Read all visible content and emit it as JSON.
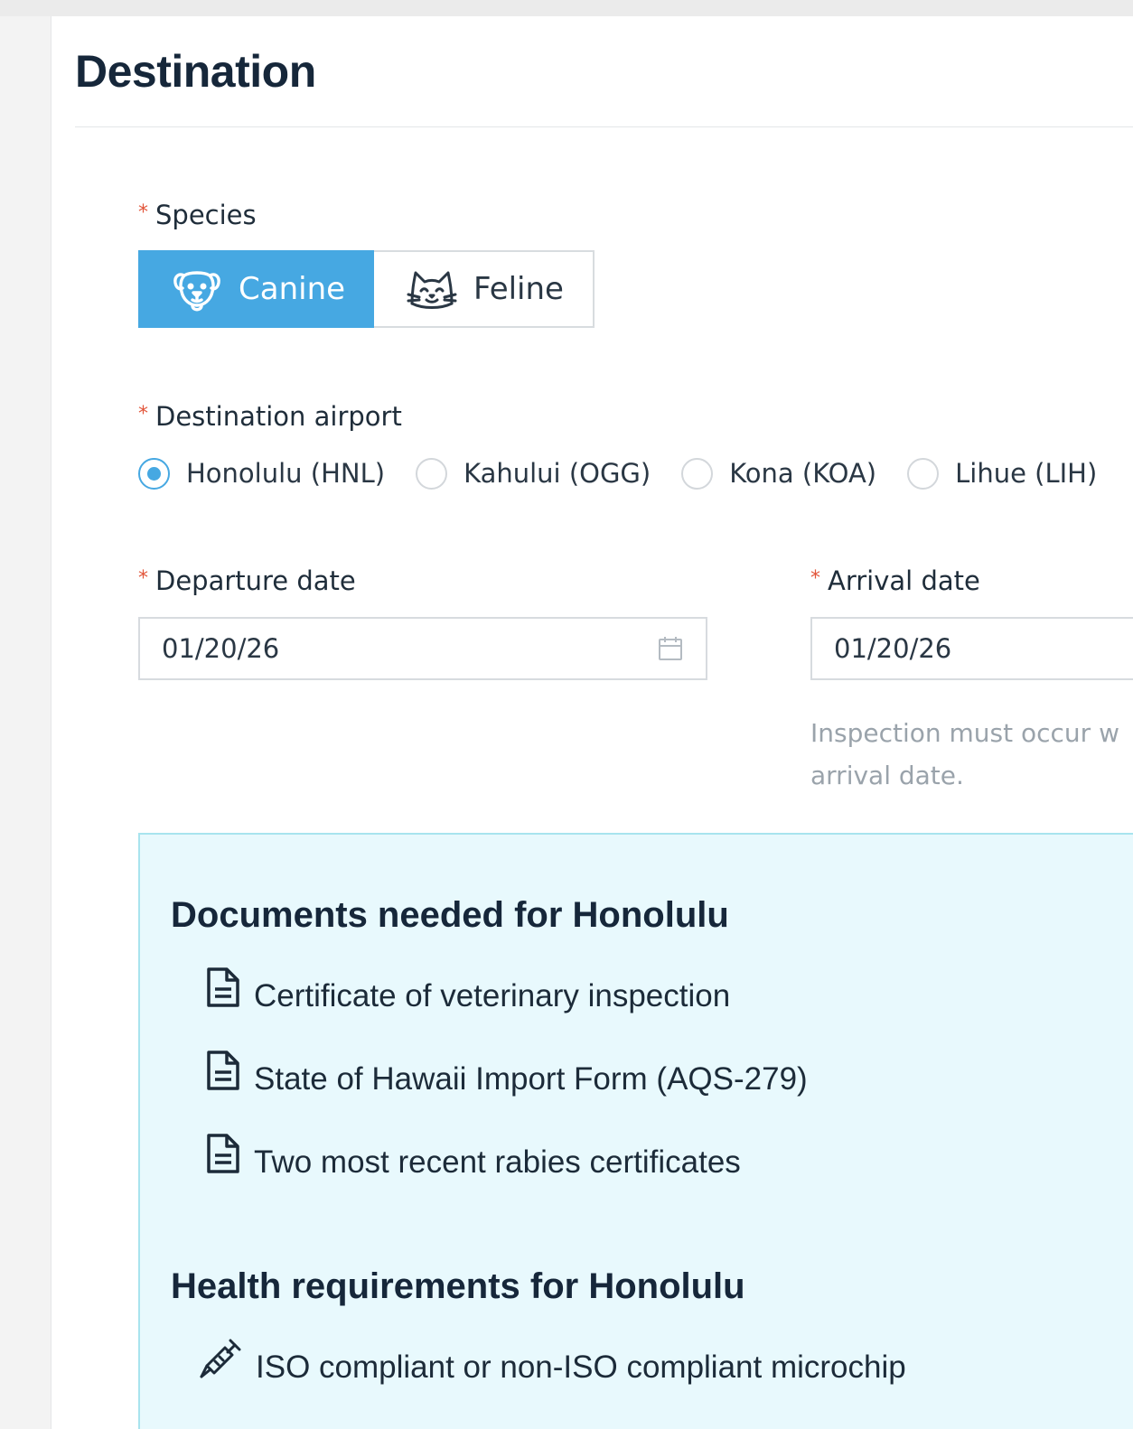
{
  "header": {
    "title": "Destination"
  },
  "species": {
    "label": "Species",
    "required_mark": "*",
    "options": [
      {
        "label": "Canine",
        "icon": "dog-icon",
        "selected": true
      },
      {
        "label": "Feline",
        "icon": "cat-icon",
        "selected": false
      }
    ]
  },
  "airport": {
    "label": "Destination airport",
    "required_mark": "*",
    "options": [
      {
        "label": "Honolulu (HNL)",
        "selected": true
      },
      {
        "label": "Kahului (OGG)",
        "selected": false
      },
      {
        "label": "Kona (KOA)",
        "selected": false
      },
      {
        "label": "Lihue (LIH)",
        "selected": false
      }
    ]
  },
  "departure": {
    "label": "Departure date",
    "required_mark": "*",
    "value": "01/20/26",
    "icon": "calendar-icon"
  },
  "arrival": {
    "label": "Arrival date",
    "required_mark": "*",
    "value": "01/20/26",
    "hint_line1": "Inspection must occur w",
    "hint_line2": "arrival date."
  },
  "documents": {
    "heading": "Documents needed for Honolulu",
    "items": [
      {
        "label": "Certificate of veterinary inspection",
        "icon": "document-icon"
      },
      {
        "label": "State of Hawaii Import Form (AQS-279)",
        "icon": "document-icon"
      },
      {
        "label": "Two most recent rabies certificates",
        "icon": "document-icon"
      }
    ]
  },
  "health": {
    "heading": "Health requirements for Honolulu",
    "items": [
      {
        "label": "ISO compliant or non-ISO compliant microchip",
        "icon": "syringe-icon"
      }
    ]
  },
  "colors": {
    "accent": "#46a8e2",
    "required": "#e2553a",
    "info_bg": "#e8f9fd",
    "info_border": "#a8e4ee",
    "hint_text": "#9aa3ab"
  }
}
